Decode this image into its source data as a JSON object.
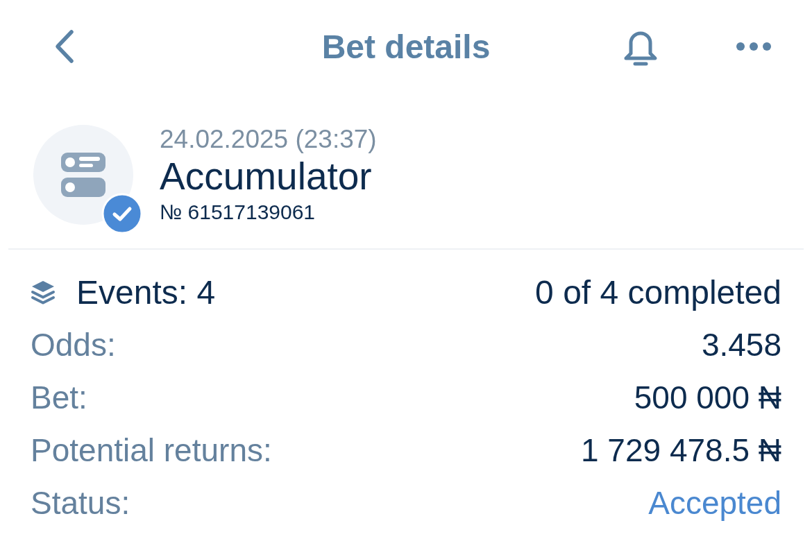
{
  "header": {
    "title": "Bet details"
  },
  "bet": {
    "date": "24.02.2025 (23:37)",
    "type": "Accumulator",
    "number": "№ 61517139061",
    "confirmed": true
  },
  "events": {
    "label": "Events: 4",
    "completed": "0 of 4 completed"
  },
  "details": [
    {
      "kind": "plain",
      "label": "Odds:",
      "value": "3.458"
    },
    {
      "kind": "plain",
      "label": "Bet:",
      "value": "500 000 ₦"
    },
    {
      "kind": "plain",
      "label": "Potential returns:",
      "value": "1 729 478.5 ₦"
    },
    {
      "kind": "status",
      "label": "Status:",
      "value": "Accepted"
    }
  ]
}
